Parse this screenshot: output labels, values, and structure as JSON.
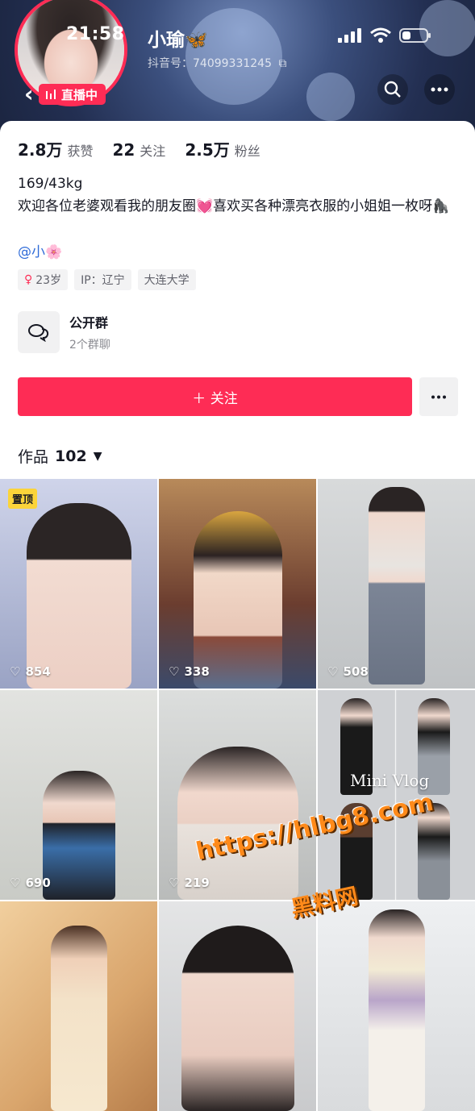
{
  "status_bar": {
    "time": "21:58"
  },
  "profile": {
    "name": "小瑜🦋",
    "douyin_id": "抖音号：74099331245",
    "live_label": "直播中",
    "stats": [
      {
        "value": "2.8万",
        "label": "获赞"
      },
      {
        "value": "22",
        "label": "关注"
      },
      {
        "value": "2.5万",
        "label": "粉丝"
      }
    ],
    "bio_line1": "169/43kg",
    "bio_line2": "欢迎各位老婆观看我的朋友圈💓喜欢买各种漂亮衣服的小姐姐一枚呀🦍",
    "mention": "@小🌸",
    "tags": {
      "age": "23岁",
      "ip": "IP：辽宁",
      "school": "大连大学"
    },
    "group": {
      "title": "公开群",
      "subtitle": "2个群聊"
    },
    "follow_label": "＋ 关注"
  },
  "works": {
    "label": "作品",
    "count": "102"
  },
  "videos": [
    {
      "likes": "854",
      "pinned_label": "置顶",
      "bg": "#b9c0d8"
    },
    {
      "likes": "338",
      "bg": "#8b5a4a"
    },
    {
      "likes": "508",
      "bg": "#c9cccf"
    },
    {
      "likes": "690",
      "bg": "#d8dad6"
    },
    {
      "likes": "219",
      "bg": "#d2d4d3"
    },
    {
      "likes": "",
      "overlay": "Mini Vlog",
      "bg": "#c7c9cc"
    },
    {
      "likes": "",
      "bg": "#e0b98f"
    },
    {
      "likes": "",
      "bg": "#dadbdc"
    },
    {
      "likes": "",
      "bg": "#e3e4e6"
    }
  ],
  "watermark": {
    "url": "https://hlbg8.com",
    "site": "黑料网"
  },
  "colors": {
    "accent": "#fe2c55",
    "link": "#2f6bd8",
    "pin": "#fbd43a"
  }
}
